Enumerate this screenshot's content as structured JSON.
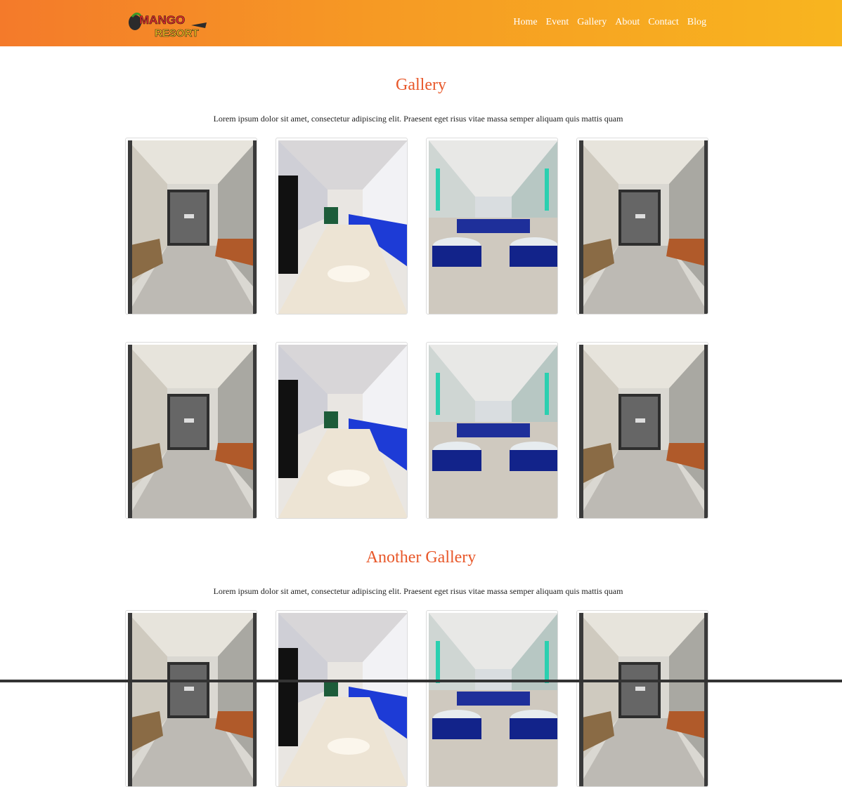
{
  "header": {
    "logo_alt": "Mango Resort",
    "logo_text_top": "MANGO",
    "logo_text_bottom": "RESORT",
    "nav": [
      {
        "label": "Home"
      },
      {
        "label": "Event"
      },
      {
        "label": "Gallery"
      },
      {
        "label": "About"
      },
      {
        "label": "Contact"
      },
      {
        "label": "Blog"
      }
    ]
  },
  "galleries": [
    {
      "title": "Gallery",
      "description": "Lorem ipsum dolor sit amet, consectetur adipiscing elit. Praesent eget risus vitae massa semper aliquam quis mattis quam",
      "rows": 2,
      "photos": [
        "lobby",
        "hall-blue-chairs",
        "banquet-tables",
        "lobby"
      ]
    },
    {
      "title": "Another Gallery",
      "description": "Lorem ipsum dolor sit amet, consectetur adipiscing elit. Praesent eget risus vitae massa semper aliquam quis mattis quam",
      "rows": 1,
      "photos": [
        "lobby",
        "hall-blue-chairs",
        "banquet-tables",
        "lobby"
      ]
    }
  ],
  "colors": {
    "header_start": "#f47a2a",
    "header_end": "#f8b51f",
    "title": "#e8582a"
  }
}
